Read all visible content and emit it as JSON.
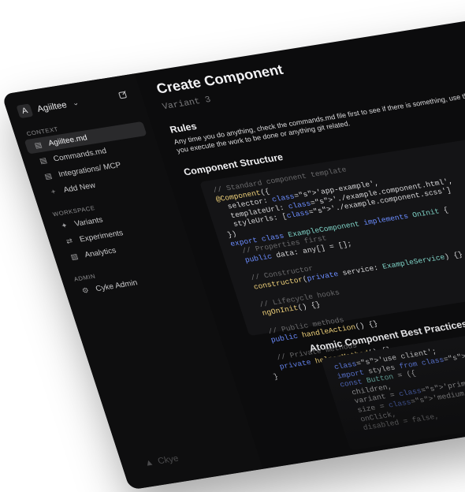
{
  "workspace": {
    "avatar_letter": "A",
    "name": "Agiiltee"
  },
  "sidebar": {
    "context_label": "CONTEXT",
    "context_items": [
      {
        "label": "Agiiltee.md",
        "icon": "file-icon",
        "active": true
      },
      {
        "label": "Commands.md",
        "icon": "file-icon"
      },
      {
        "label": "Integrations/ MCP",
        "icon": "file-icon"
      },
      {
        "label": "Add New",
        "icon": "plus-icon"
      }
    ],
    "workspace_label": "WORKSPACE",
    "workspace_items": [
      {
        "label": "Variants",
        "icon": "variants-icon"
      },
      {
        "label": "Experiments",
        "icon": "shuffle-icon"
      },
      {
        "label": "Analytics",
        "icon": "analytics-icon"
      }
    ],
    "admin_label": "ADMIN",
    "admin_items": [
      {
        "label": "Cyke Admin",
        "icon": "admin-icon"
      }
    ],
    "footer_brand": "Ckye"
  },
  "main": {
    "title": "Create Component",
    "subtitle": "Variant 3",
    "rules_heading": "Rules",
    "rules_text": "Any time you do anything, check the commands.md file first to see if there is something, use those instructions instead. Then when you execute the work to be done or anything git related.",
    "structure_heading": "Component Structure",
    "code_lines": [
      "// Standard component template",
      "@Component({",
      "  selector: 'app-example',",
      "  templateUrl: './example.component.html',",
      "  styleUrls: ['./example.component.scss']",
      "})",
      "export class ExampleComponent implements OnInit {",
      "  // Properties first",
      "  public data: any[] = [];",
      "",
      "  // Constructor",
      "  constructor(private service: ExampleService) {}",
      "",
      "  // Lifecycle hooks",
      "  ngOnInit() {}",
      "",
      "  // Public methods",
      "  public handleAction() {}",
      "",
      "  // Private methods",
      "  private helperMethod() {}",
      "}"
    ],
    "atomic_heading": "Atomic Component Best Practices",
    "code2_lines": [
      "'use client';",
      "import styles from './Button.module.css';",
      "const Button = ({",
      "  children,",
      "  variant = 'primary',",
      "  size = 'medium',",
      "  onClick,",
      "  disabled = false,"
    ]
  }
}
